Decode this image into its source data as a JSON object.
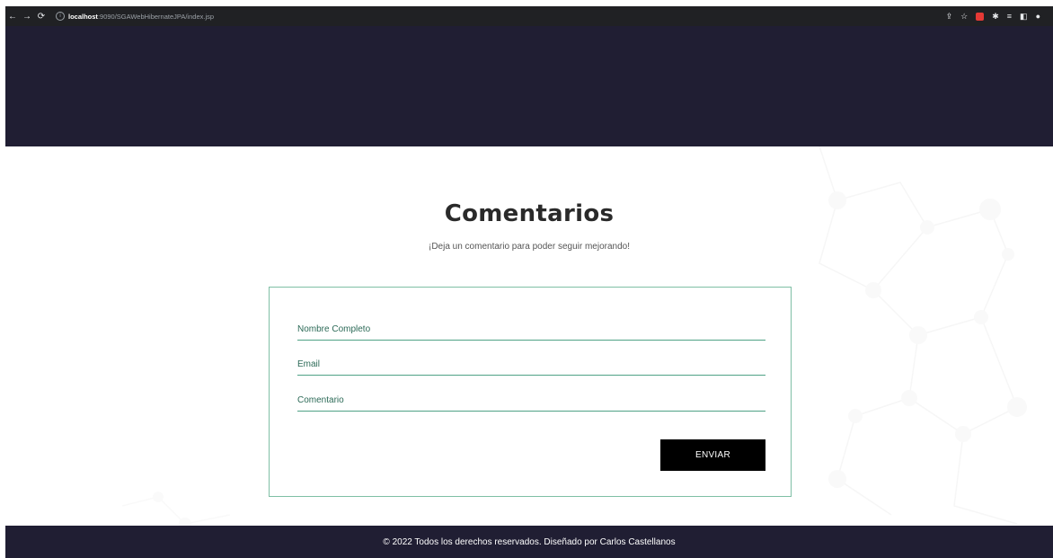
{
  "browser": {
    "url_host": "localhost",
    "url_path": ":9090/SGAWebHibernateJPA/index.jsp"
  },
  "main": {
    "title": "Comentarios",
    "subtitle": "¡Deja un comentario para poder seguir mejorando!"
  },
  "form": {
    "name_placeholder": "Nombre Completo",
    "email_placeholder": "Email",
    "comment_placeholder": "Comentario",
    "submit_label": "ENVIAR"
  },
  "footer": {
    "text": "© 2022 Todos los derechos reservados. Diseñado por Carlos Castellanos"
  },
  "colors": {
    "header_bg": "#201e33",
    "form_border": "#7fbfa5",
    "field_text": "#2c6a57",
    "button_bg": "#000000"
  }
}
